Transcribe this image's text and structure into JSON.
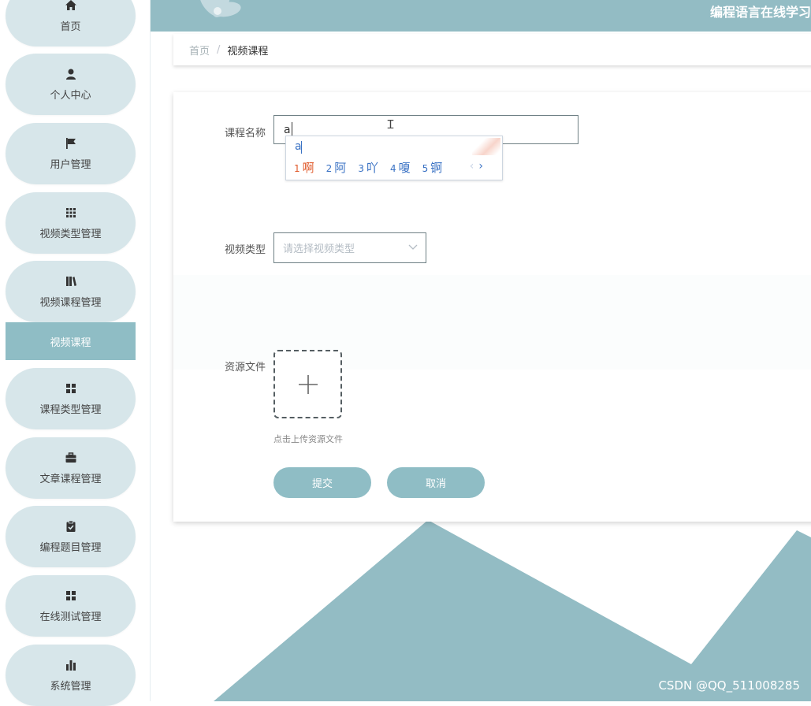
{
  "app_title": "编程语言在线学习",
  "sidebar": {
    "items": [
      {
        "label": "首页",
        "icon": "home-icon"
      },
      {
        "label": "个人中心",
        "icon": "user-icon"
      },
      {
        "label": "用户管理",
        "icon": "flag-icon"
      },
      {
        "label": "视频类型管理",
        "icon": "grid-icon"
      },
      {
        "label": "视频课程管理",
        "icon": "book-icon"
      },
      {
        "label": "课程类型管理",
        "icon": "apps-icon"
      },
      {
        "label": "文章课程管理",
        "icon": "briefcase-icon"
      },
      {
        "label": "编程题目管理",
        "icon": "clipboard-check-icon"
      },
      {
        "label": "在线测试管理",
        "icon": "apps-icon"
      },
      {
        "label": "系统管理",
        "icon": "bar-chart-icon"
      }
    ],
    "active_sub": "视频课程"
  },
  "breadcrumb": {
    "home": "首页",
    "separator": "/",
    "current": "视频课程"
  },
  "form": {
    "name_label": "课程名称",
    "name_value": "a",
    "type_label": "视频类型",
    "type_placeholder": "请选择视频类型",
    "file_label": "资源文件",
    "upload_tip": "点击上传资源文件",
    "submit": "提交",
    "cancel": "取消"
  },
  "ime": {
    "composition": "a",
    "candidates": [
      {
        "num": "1",
        "text": "啊"
      },
      {
        "num": "2",
        "text": "阿"
      },
      {
        "num": "3",
        "text": "吖"
      },
      {
        "num": "4",
        "text": "嗄"
      },
      {
        "num": "5",
        "text": "锕"
      }
    ],
    "prev": "‹",
    "next": "›"
  },
  "watermark": "CSDN @QQ_511008285",
  "colors": {
    "accent": "#8fbdc5",
    "nav_bg": "#d7e6ea",
    "topbar": "#93bcc4",
    "ime_selected": "#e05a2b",
    "ime_text": "#3a72c4"
  }
}
